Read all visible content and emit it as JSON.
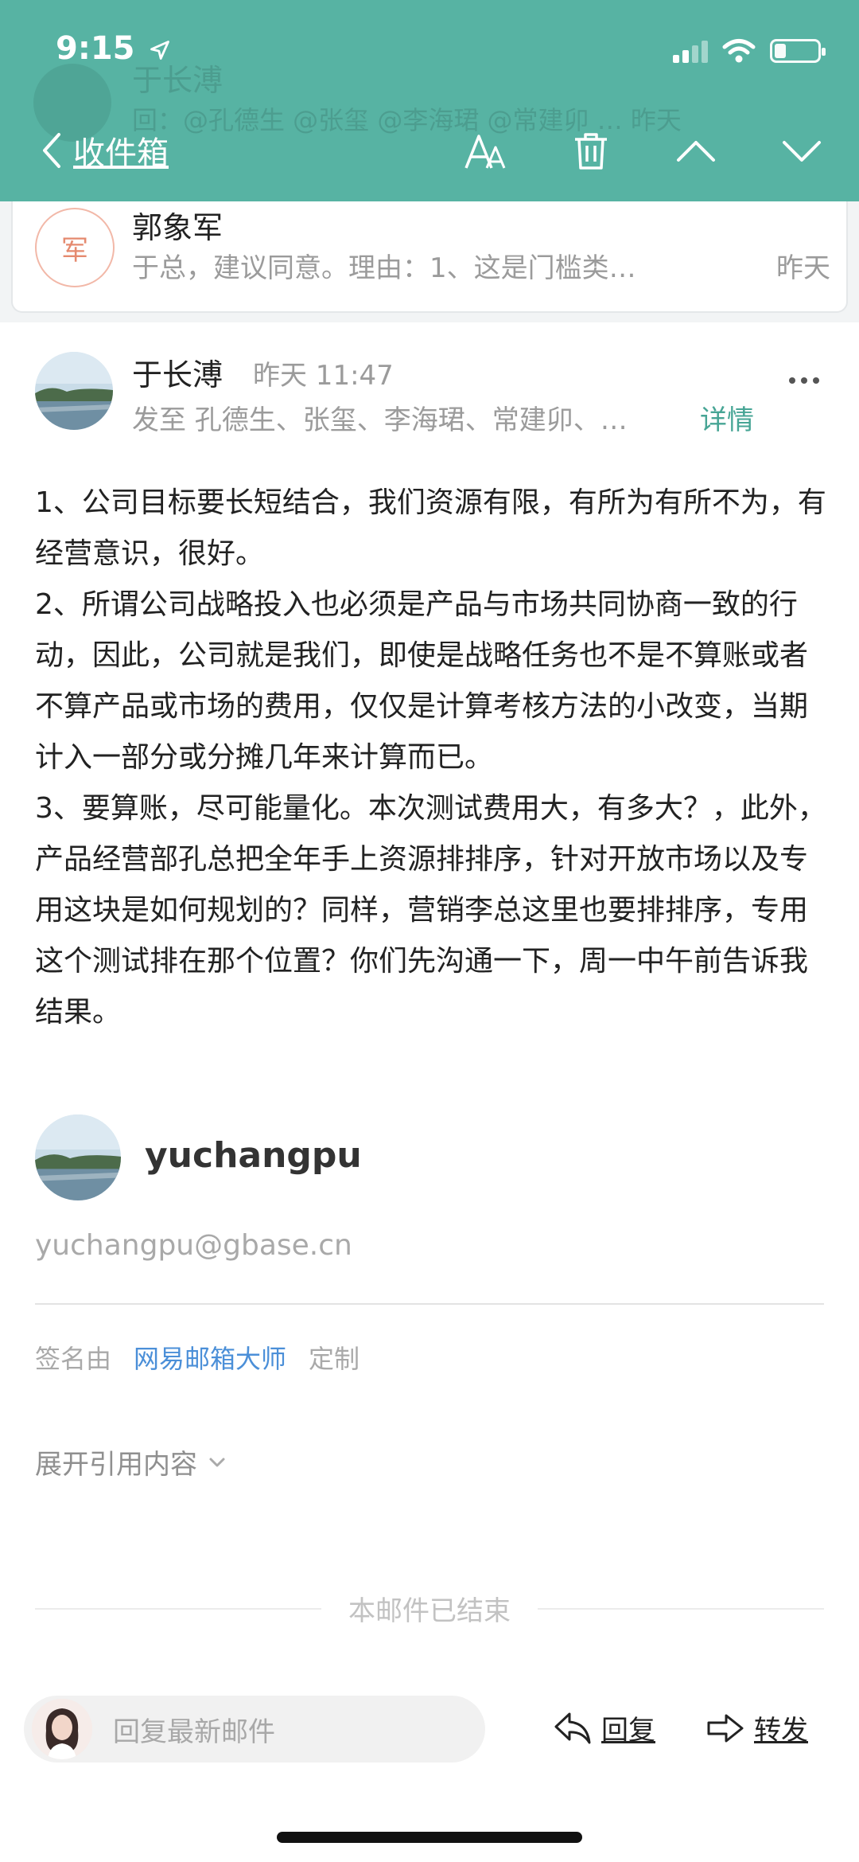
{
  "status_bar": {
    "time": "9:15"
  },
  "ghost_row": {
    "sender": "于长溥",
    "preview": "回：@孔德生 @张玺 @李海珺 @常建卯 …  昨天"
  },
  "nav": {
    "back_label": "收件箱",
    "icons": [
      "text-size-icon",
      "trash-icon",
      "chevron-up-icon",
      "chevron-down-icon"
    ]
  },
  "previous_email": {
    "avatar_char": "军",
    "sender": "郭象军",
    "preview": "于总，建议同意。理由：1、这是门槛类…",
    "date": "昨天"
  },
  "email": {
    "sender": "于长溥",
    "time": "昨天 11:47",
    "recipients": "发至 孔德生、张玺、李海珺、常建卯、…",
    "details_label": "详情",
    "paragraphs": [
      "1、公司目标要长短结合，我们资源有限，有所为有所不为，有经营意识，很好。",
      "2、所谓公司战略投入也必须是产品与市场共同协商一致的行动，因此，公司就是我们，即使是战略任务也不是不算账或者不算产品或市场的费用，仅仅是计算考核方法的小改变，当期计入一部分或分摊几年来计算而已。",
      "3、要算账，尽可能量化。本次测试费用大，有多大？，此外，产品经营部孔总把全年手上资源排排序，针对开放市场以及专用这块是如何规划的？同样，营销李总这里也要排排序，专用这个测试排在那个位置？你们先沟通一下，周一中午前告诉我结果。"
    ]
  },
  "signature": {
    "name": "yuchangpu",
    "email": "yuchangpu@gbase.cn",
    "signed_by": "签名由",
    "brand": "网易邮箱大师",
    "customize": "定制"
  },
  "expand_quote_label": "展开引用内容",
  "end_label": "本邮件已结束",
  "bottom_bar": {
    "reply_placeholder": "回复最新邮件",
    "reply_label": "回复",
    "forward_label": "转发"
  },
  "colors": {
    "header": "#57b3a3",
    "accent": "#47a595",
    "brand_link": "#4b8fd8"
  }
}
